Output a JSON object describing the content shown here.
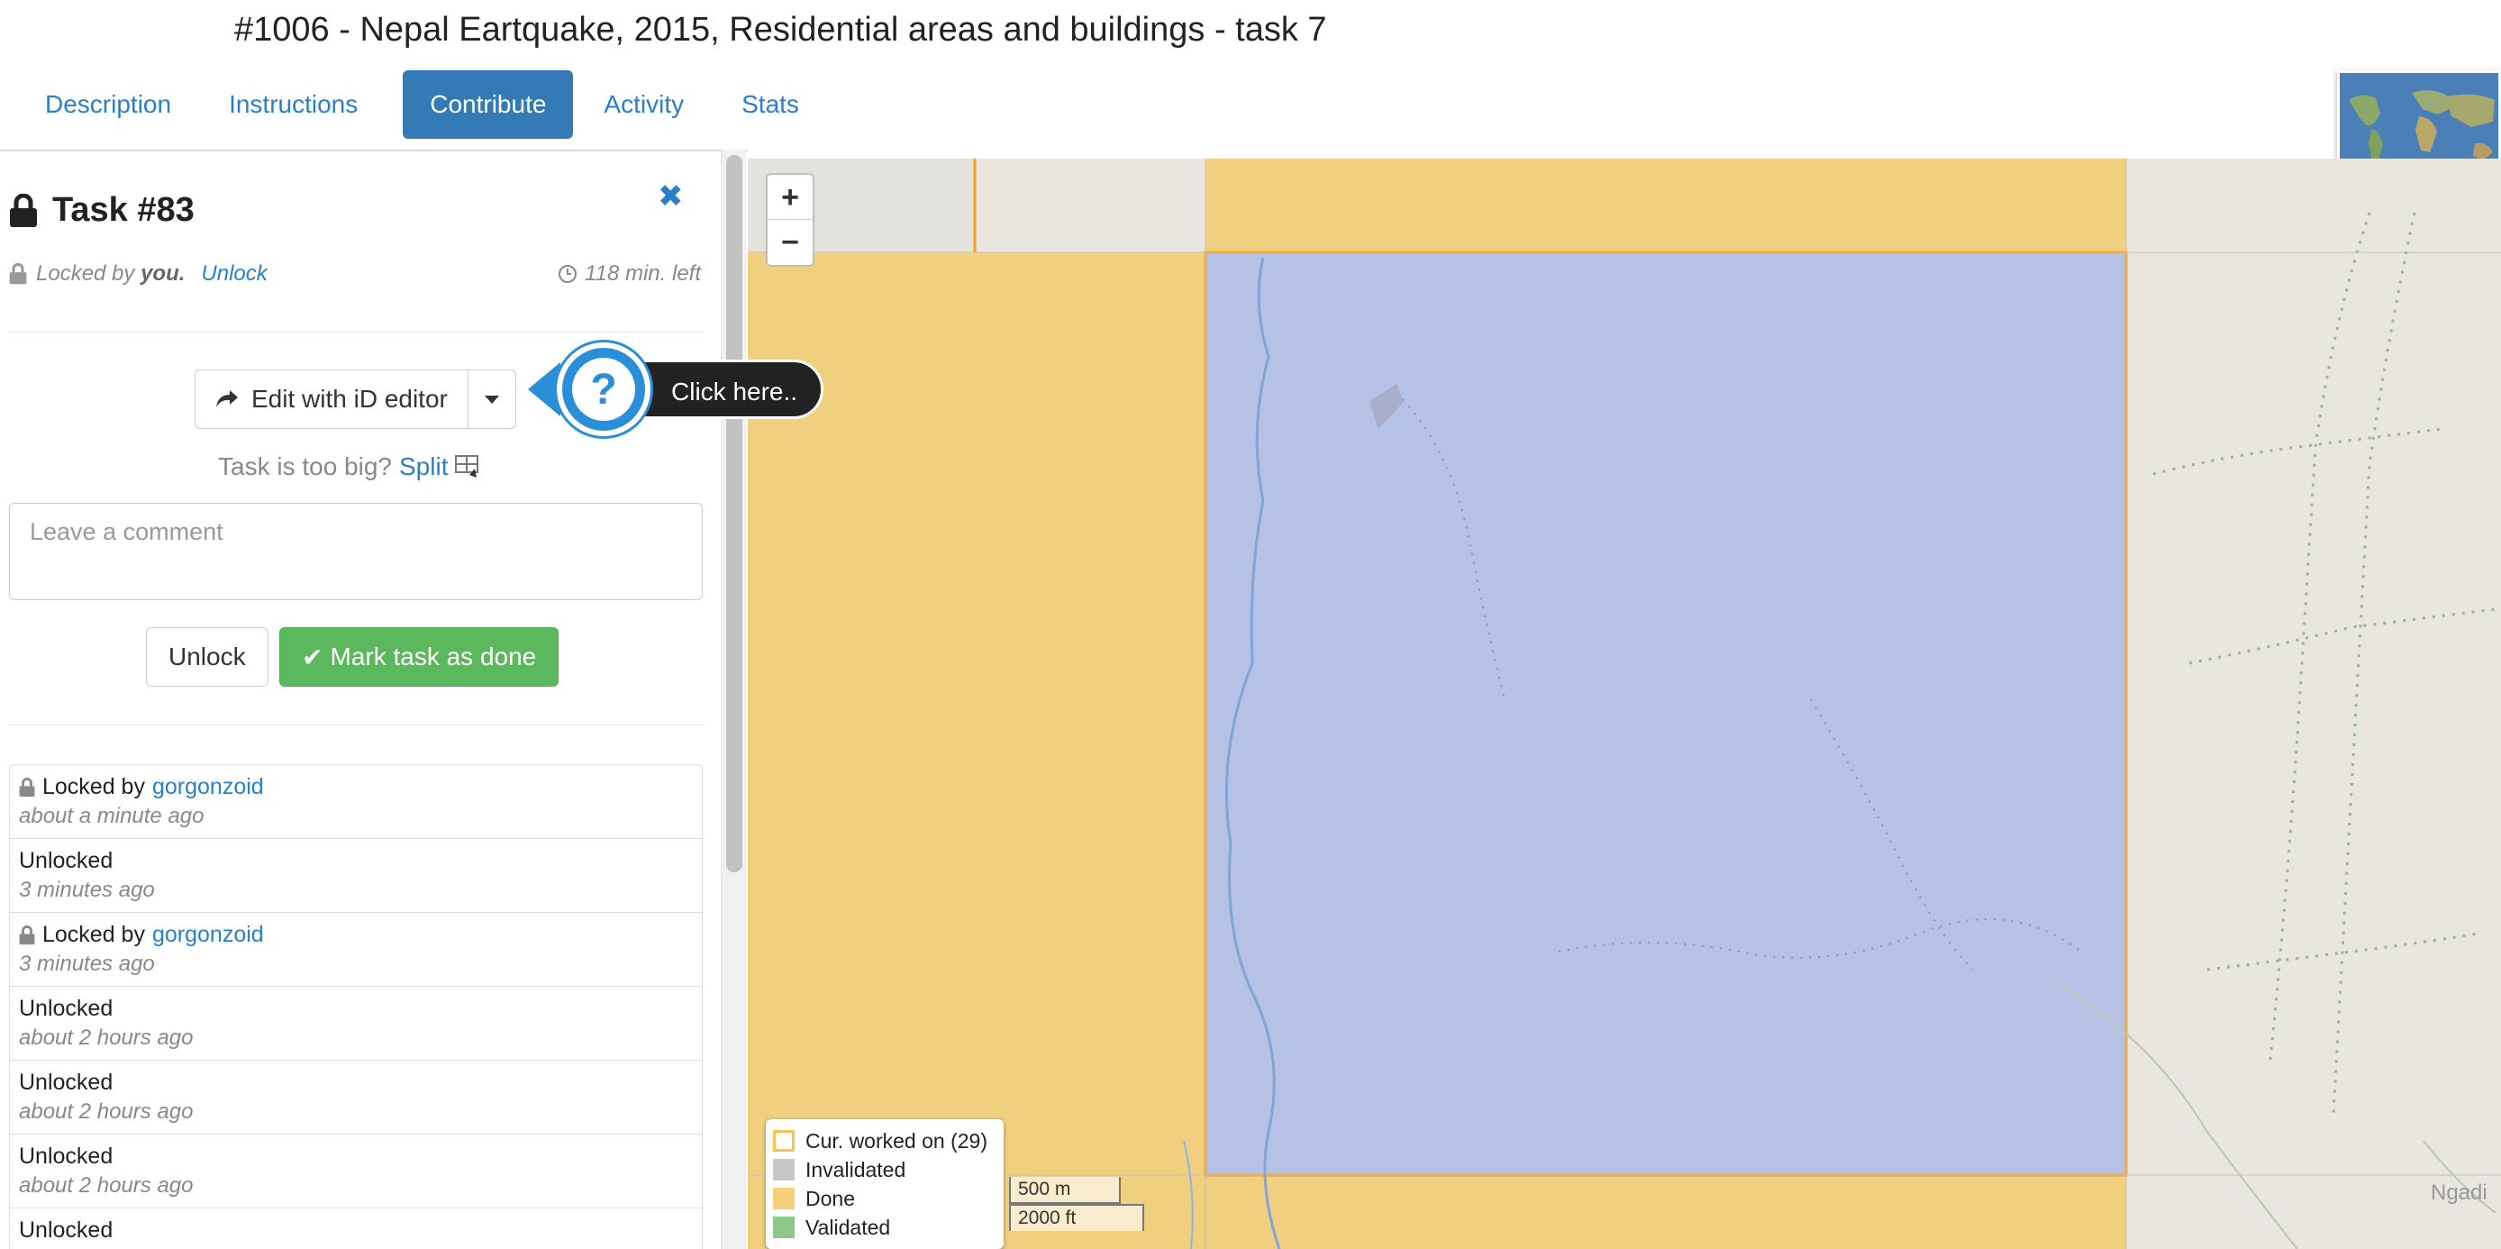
{
  "page": {
    "title": "#1006 - Nepal Eartquake, 2015, Residential areas and buildings - task 7"
  },
  "tabs": [
    {
      "label": "Description"
    },
    {
      "label": "Instructions"
    },
    {
      "label": "Contribute"
    },
    {
      "label": "Activity"
    },
    {
      "label": "Stats"
    }
  ],
  "task": {
    "title": "Task #83",
    "locked_by_prefix": "Locked by",
    "locked_by_user": "you.",
    "unlock_link": "Unlock",
    "time_left": "118 min. left",
    "edit_button": "Edit with iD editor",
    "split_prompt": "Task is too big?",
    "split_link": "Split",
    "comment_placeholder": "Leave a comment",
    "unlock_button": "Unlock",
    "done_button": "Mark task as done"
  },
  "tooltip": {
    "label": "Click here.."
  },
  "history": [
    {
      "action": "Locked by",
      "user": "gorgonzoid",
      "time": "about a minute ago",
      "locked": true
    },
    {
      "action": "Unlocked",
      "user": "",
      "time": "3 minutes ago",
      "locked": false
    },
    {
      "action": "Locked by",
      "user": "gorgonzoid",
      "time": "3 minutes ago",
      "locked": true
    },
    {
      "action": "Unlocked",
      "user": "",
      "time": "about 2 hours ago",
      "locked": false
    },
    {
      "action": "Unlocked",
      "user": "",
      "time": "about 2 hours ago",
      "locked": false
    },
    {
      "action": "Unlocked",
      "user": "",
      "time": "about 2 hours ago",
      "locked": false
    },
    {
      "action": "Unlocked",
      "user": "",
      "time": "",
      "locked": false
    }
  ],
  "map": {
    "zoom_in": "+",
    "zoom_out": "−",
    "legend": [
      {
        "label": "Cur. worked on (29)",
        "color": "#ffffff",
        "border": "#f6c74a"
      },
      {
        "label": "Invalidated",
        "color": "#c8c8c8",
        "border": "#c8c8c8"
      },
      {
        "label": "Done",
        "color": "#f5cf79",
        "border": "#f5cf79"
      },
      {
        "label": "Validated",
        "color": "#8cc78c",
        "border": "#8cc78c"
      }
    ],
    "scale_metric": "500 m",
    "scale_imperial": "2000 ft",
    "place_label": "Ngadi",
    "colors": {
      "done": "#f0cf7f",
      "selected": "#b6c1e6",
      "border": "#f3a21f"
    }
  }
}
